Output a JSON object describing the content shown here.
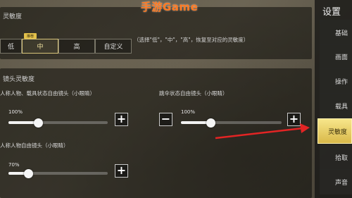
{
  "watermark": "手游Game",
  "settings_nav": {
    "title": "设置",
    "items": [
      "基础",
      "画面",
      "操作",
      "载具",
      "灵敏度",
      "拾取",
      "声音"
    ],
    "active_index": 4
  },
  "sensitivity_section": {
    "title": "灵敏度",
    "options": [
      "低",
      "中",
      "高",
      "自定义"
    ],
    "selected": "中",
    "selected_badge": "推荐",
    "hint": "（选择\"低\"，\"中\"，\"高\"，恢复至对应的灵敏度）"
  },
  "camera_section": {
    "title": "镜头灵敏度",
    "sliders": [
      {
        "label": "人称人物、载具状态自由镜头（小眼睛）",
        "value_text": "100%",
        "value": 0.3
      },
      {
        "label": "跳伞状态自由镜头（小眼睛）",
        "value_text": "100%",
        "value": 0.3
      },
      {
        "label": "人称人物自由镜头（小眼睛）",
        "value_text": "70%",
        "value": 0.2
      }
    ]
  },
  "colors": {
    "accent": "#e2c04a",
    "arrow": "#e32424",
    "watermark": "#ff7a22"
  }
}
